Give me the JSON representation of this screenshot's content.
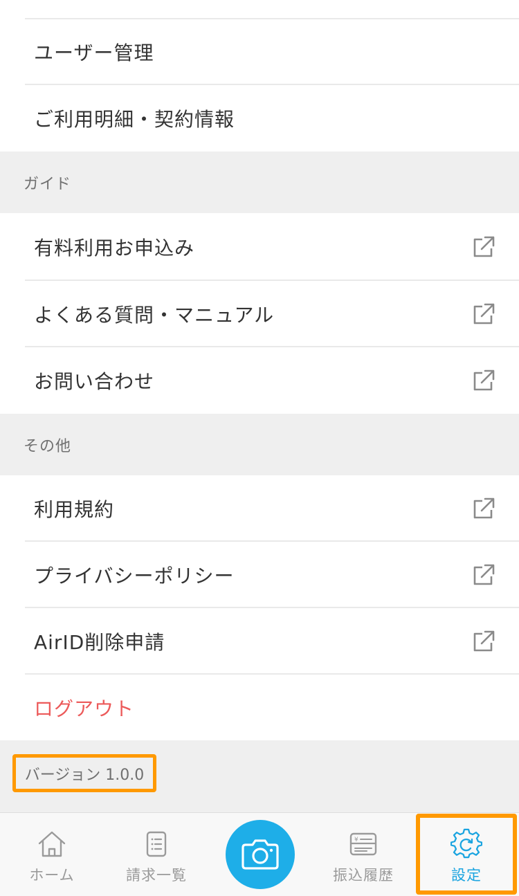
{
  "menu": {
    "top_items": [
      {
        "label": "ユーザー管理"
      },
      {
        "label": "ご利用明細・契約情報"
      }
    ],
    "guide_section": {
      "title": "ガイド",
      "items": [
        {
          "label": "有料利用お申込み"
        },
        {
          "label": "よくある質問・マニュアル"
        },
        {
          "label": "お問い合わせ"
        }
      ]
    },
    "other_section": {
      "title": "その他",
      "items": [
        {
          "label": "利用規約"
        },
        {
          "label": "プライバシーポリシー"
        },
        {
          "label": "AirID削除申請"
        }
      ]
    },
    "logout_label": "ログアウト",
    "version_text": "バージョン 1.0.0"
  },
  "tabbar": {
    "tabs": [
      {
        "label": "ホーム",
        "icon": "home-icon"
      },
      {
        "label": "請求一覧",
        "icon": "document-list-icon"
      },
      {
        "label": "",
        "icon": "camera-icon"
      },
      {
        "label": "振込履歴",
        "icon": "transfer-history-icon"
      },
      {
        "label": "設定",
        "icon": "gear-icon"
      }
    ],
    "active_tab": "設定"
  },
  "colors": {
    "accent": "#1eaee8",
    "highlight": "#ff9900",
    "logout": "#ec5a5a",
    "section_bg": "#efefef"
  }
}
